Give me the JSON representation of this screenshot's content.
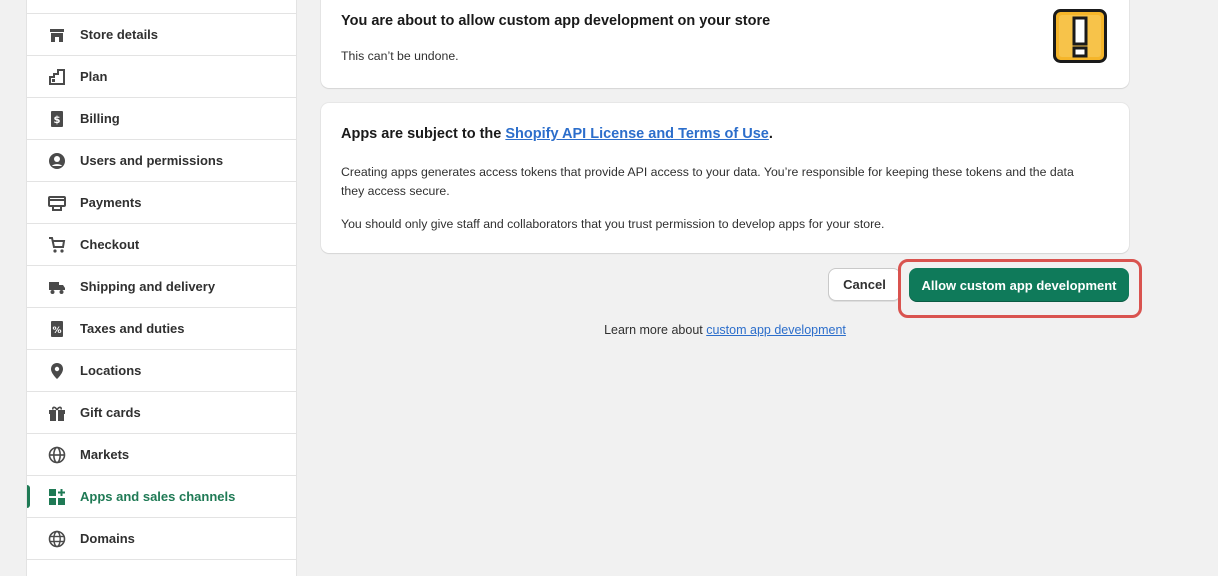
{
  "sidebar": {
    "items": [
      {
        "label": "",
        "icon": "blank"
      },
      {
        "label": "Store details",
        "icon": "store-icon"
      },
      {
        "label": "Plan",
        "icon": "plan-icon"
      },
      {
        "label": "Billing",
        "icon": "billing-icon"
      },
      {
        "label": "Users and permissions",
        "icon": "user-icon"
      },
      {
        "label": "Payments",
        "icon": "payments-icon"
      },
      {
        "label": "Checkout",
        "icon": "cart-icon"
      },
      {
        "label": "Shipping and delivery",
        "icon": "truck-icon"
      },
      {
        "label": "Taxes and duties",
        "icon": "tax-icon"
      },
      {
        "label": "Locations",
        "icon": "location-pin-icon"
      },
      {
        "label": "Gift cards",
        "icon": "gift-icon"
      },
      {
        "label": "Markets",
        "icon": "globe-icon"
      },
      {
        "label": "Apps and sales channels",
        "icon": "apps-icon",
        "active": true
      },
      {
        "label": "Domains",
        "icon": "domains-globe-icon"
      },
      {
        "label": "",
        "icon": "partial-icon"
      }
    ],
    "active_color": "#1f7a55"
  },
  "warning_card": {
    "title": "You are about to allow custom app development on your store",
    "text": "This can’t be undone.",
    "icon": "exclamation-icon"
  },
  "terms_card": {
    "title_prefix": "Apps are subject to the ",
    "title_link": "Shopify API License and Terms of Use",
    "title_suffix": ".",
    "paragraph1": "Creating apps generates access tokens that provide API access to your data. You’re responsible for keeping these tokens and the data they access secure.",
    "paragraph2": "You should only give staff and collaborators that you trust permission to develop apps for your store."
  },
  "actions": {
    "cancel_label": "Cancel",
    "allow_label": "Allow custom app development",
    "allow_color": "#0f7a5a",
    "highlight_color": "#d9534f"
  },
  "footer": {
    "learn_prefix": "Learn more about ",
    "learn_link": "custom app development"
  }
}
